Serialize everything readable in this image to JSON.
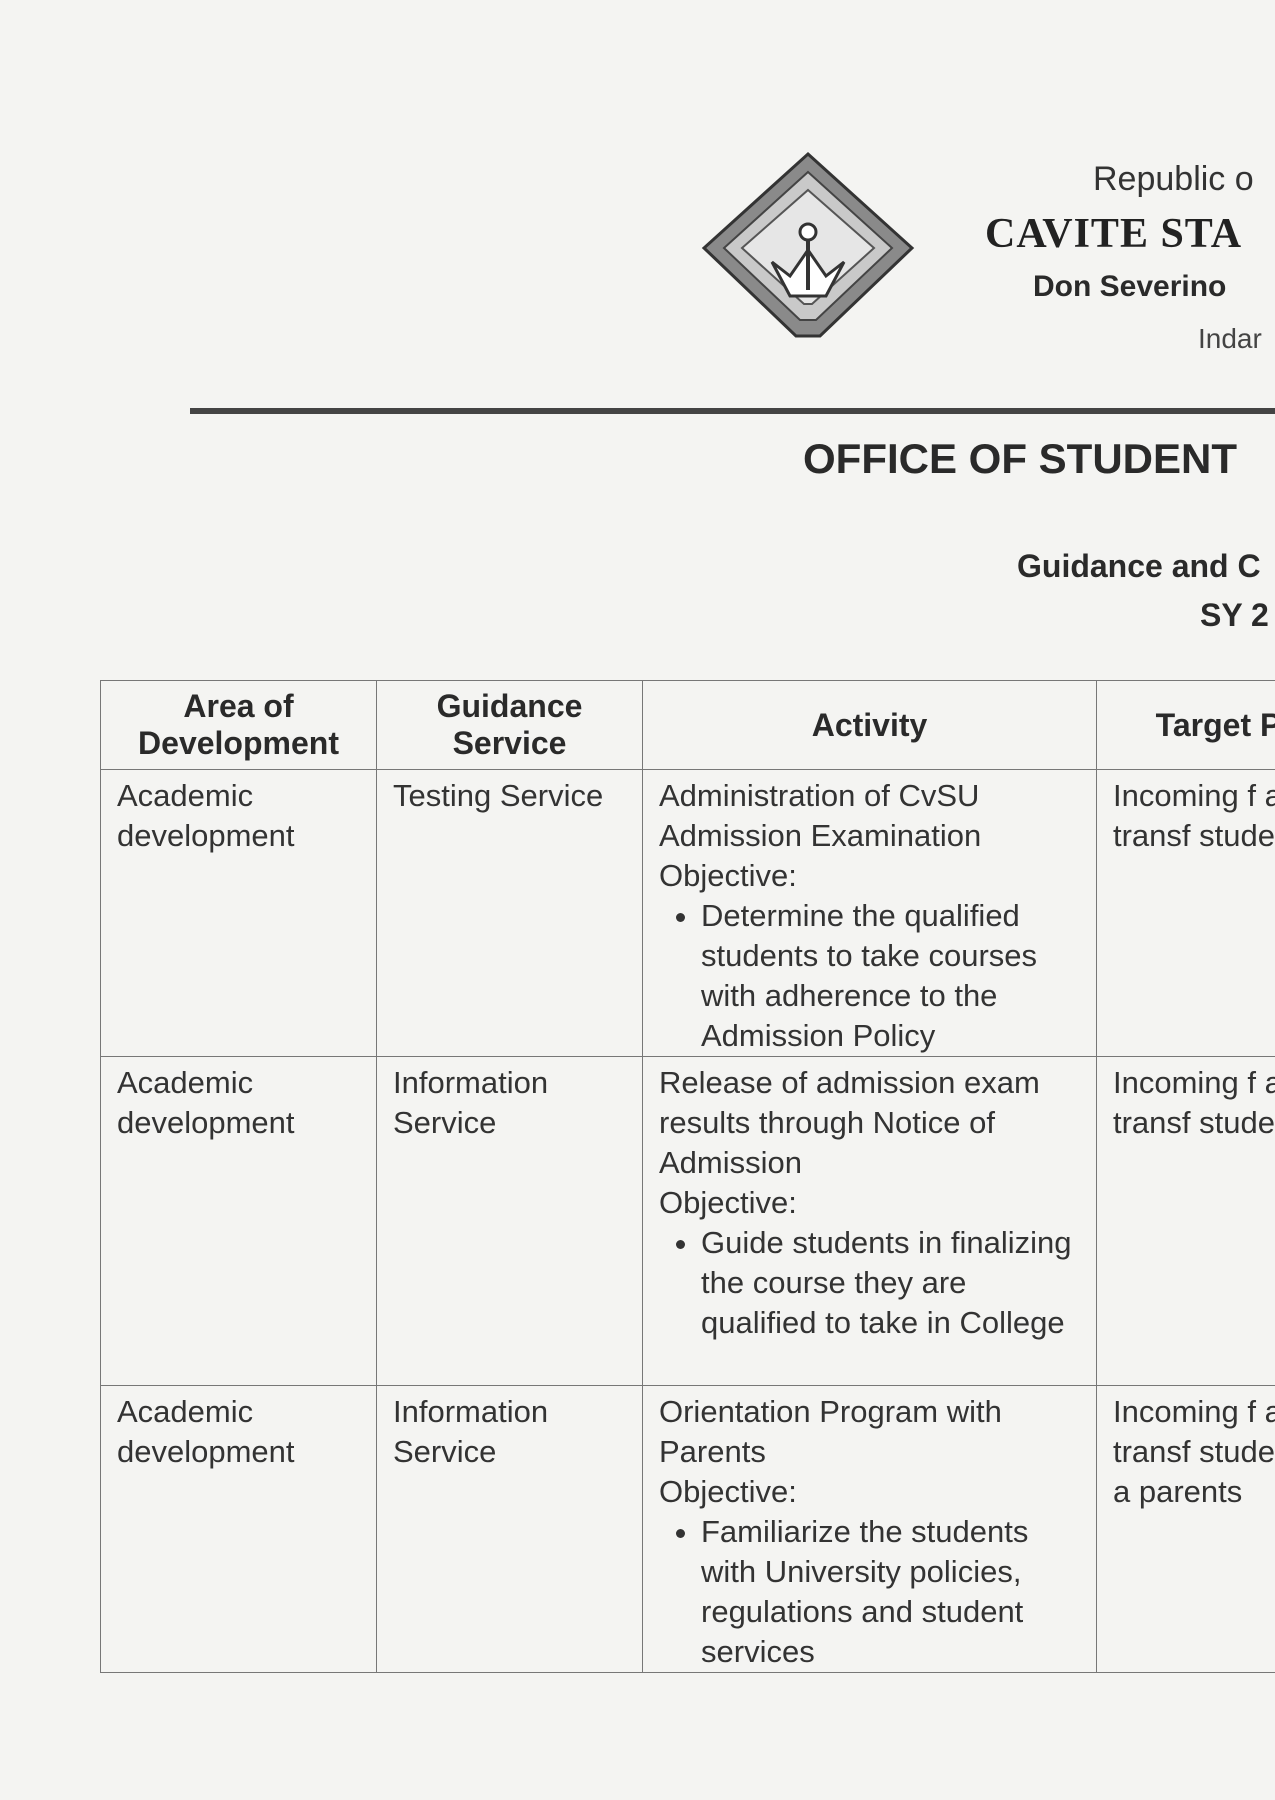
{
  "header": {
    "republic": "Republic o",
    "university": "CAVITE STA",
    "campus": "Don Severino",
    "town": "Indar",
    "office": "OFFICE OF STUDENT",
    "program": "Guidance and C",
    "school_year": "SY 2"
  },
  "table": {
    "columns": [
      "Area of Development",
      "Guidance Service",
      "Activity",
      "Target P"
    ],
    "rows": [
      {
        "area": "Academic development",
        "service": "Testing Service",
        "activity": "Administration of CvSU Admission Examination",
        "objective_label": "Objective:",
        "objective": "Determine the qualified students to take courses with adherence to the Admission Policy",
        "target": "Incoming f and transf students"
      },
      {
        "area": "Academic development",
        "service": "Information Service",
        "activity": "Release of admission exam results through Notice of Admission",
        "objective_label": "Objective:",
        "objective": "Guide students in finalizing the course they are qualified to take in College",
        "target": "Incoming f and transf students"
      },
      {
        "area": "Academic development",
        "service": "Information Service",
        "activity": "Orientation Program with Parents",
        "objective_label": "Objective:",
        "objective": "Familiarize the students with University policies, regulations and student services",
        "target": "Incoming f and transf students a parents"
      }
    ]
  }
}
